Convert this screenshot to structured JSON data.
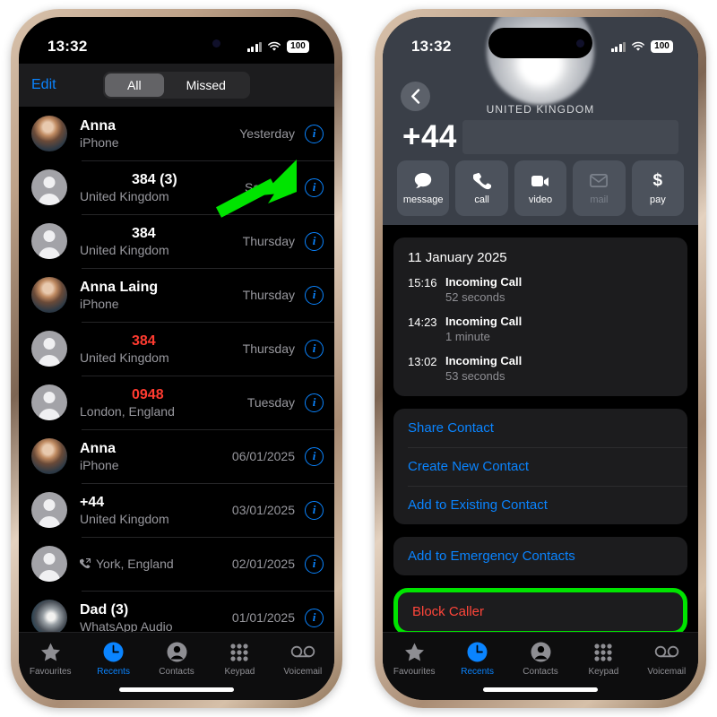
{
  "status_bar": {
    "time": "13:32",
    "battery": "100",
    "wifi_icon": "wifi-icon",
    "signal_icon": "cellular-signal-icon"
  },
  "left_phone": {
    "nav": {
      "edit_label": "Edit",
      "segments": [
        {
          "label": "All",
          "selected": true
        },
        {
          "label": "Missed",
          "selected": false
        }
      ]
    },
    "calls": [
      {
        "name": "Anna",
        "sub": "iPhone",
        "time": "Yesterday",
        "missed": false,
        "avatar": "anna-photo",
        "number_only": false,
        "forwarded": false
      },
      {
        "name": "384 (3)",
        "sub": "United Kingdom",
        "time": "Saturday",
        "missed": false,
        "avatar": "generic",
        "number_only": true,
        "forwarded": false
      },
      {
        "name": "384",
        "sub": "United Kingdom",
        "time": "Thursday",
        "missed": false,
        "avatar": "generic",
        "number_only": true,
        "forwarded": false
      },
      {
        "name": "Anna Laing",
        "sub": "iPhone",
        "time": "Thursday",
        "missed": false,
        "avatar": "anna-photo",
        "number_only": false,
        "forwarded": false
      },
      {
        "name": "384",
        "sub": "United Kingdom",
        "time": "Thursday",
        "missed": true,
        "avatar": "generic",
        "number_only": true,
        "forwarded": false
      },
      {
        "name": "0948",
        "sub": "London, England",
        "time": "Tuesday",
        "missed": true,
        "avatar": "generic",
        "number_only": true,
        "forwarded": false
      },
      {
        "name": "Anna",
        "sub": "iPhone",
        "time": "06/01/2025",
        "missed": false,
        "avatar": "anna-photo",
        "number_only": false,
        "forwarded": false
      },
      {
        "name": "+44",
        "sub": "United Kingdom",
        "time": "03/01/2025",
        "missed": false,
        "avatar": "generic",
        "number_only": false,
        "forwarded": false
      },
      {
        "name": "",
        "sub": "York, England",
        "time": "02/01/2025",
        "missed": false,
        "avatar": "generic",
        "number_only": false,
        "forwarded": true
      },
      {
        "name": "Dad (3)",
        "sub": "WhatsApp Audio",
        "time": "01/01/2025",
        "missed": false,
        "avatar": "dog-photo",
        "number_only": false,
        "forwarded": false
      }
    ]
  },
  "right_phone": {
    "back_icon": "chevron-left-icon",
    "country": "UNITED KINGDOM",
    "number_prefix": "+44",
    "actions": [
      {
        "label": "message",
        "icon": "message-bubble-icon",
        "disabled": false
      },
      {
        "label": "call",
        "icon": "phone-icon",
        "disabled": false
      },
      {
        "label": "video",
        "icon": "video-camera-icon",
        "disabled": false
      },
      {
        "label": "mail",
        "icon": "envelope-icon",
        "disabled": true
      },
      {
        "label": "pay",
        "icon": "dollar-sign-icon",
        "disabled": false
      }
    ],
    "history": {
      "date": "11 January 2025",
      "entries": [
        {
          "time": "15:16",
          "type": "Incoming Call",
          "duration": "52 seconds"
        },
        {
          "time": "14:23",
          "type": "Incoming Call",
          "duration": "1 minute"
        },
        {
          "time": "13:02",
          "type": "Incoming Call",
          "duration": "53 seconds"
        }
      ]
    },
    "contact_actions": [
      "Share Contact",
      "Create New Contact",
      "Add to Existing Contact"
    ],
    "emergency_action": "Add to Emergency Contacts",
    "block_action": "Block Caller"
  },
  "tab_bar": [
    {
      "label": "Favourites",
      "icon": "star-icon",
      "active": false
    },
    {
      "label": "Recents",
      "icon": "clock-icon",
      "active": true
    },
    {
      "label": "Contacts",
      "icon": "person-icon",
      "active": false
    },
    {
      "label": "Keypad",
      "icon": "keypad-icon",
      "active": false
    },
    {
      "label": "Voicemail",
      "icon": "voicemail-icon",
      "active": false
    }
  ],
  "annotations": {
    "arrow_color": "#00e400",
    "highlight_color": "#00e400",
    "arrow_target": "info-button-saturday-row",
    "highlight_target": "block-caller-row"
  }
}
